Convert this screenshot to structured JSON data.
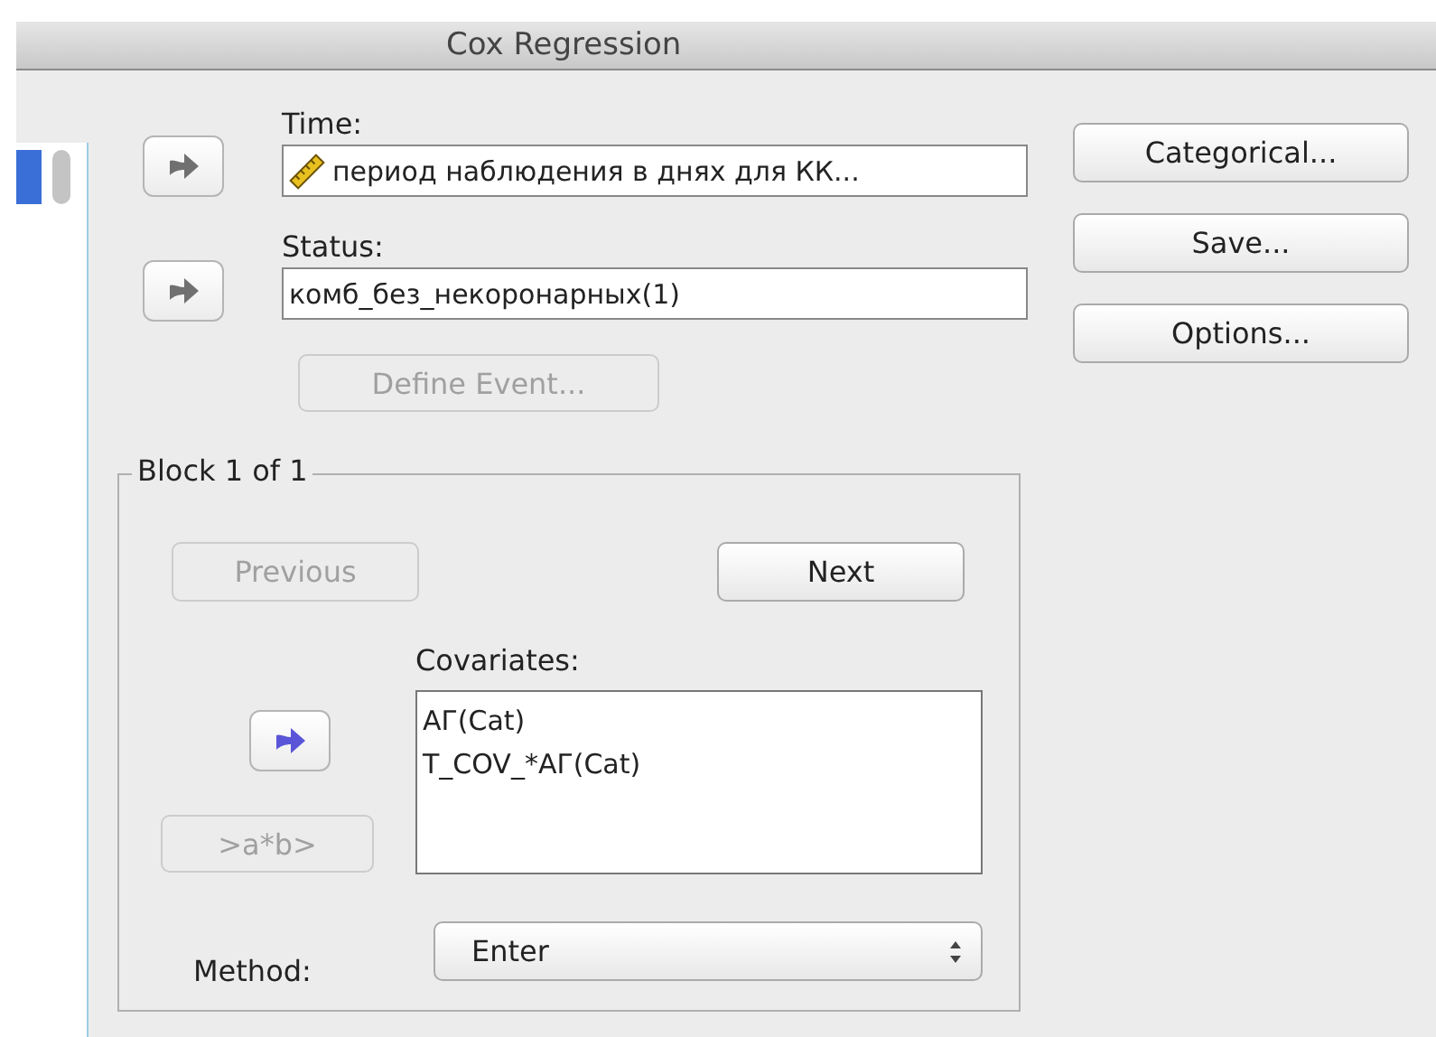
{
  "window": {
    "title": "Cox Regression"
  },
  "source_list": {
    "rows": [
      {
        "selected": true
      }
    ]
  },
  "time": {
    "label": "Time:",
    "value": "период наблюдения в днях для КК...",
    "scale_icon": true,
    "move_button": {
      "disabled": true
    }
  },
  "status": {
    "label": "Status:",
    "value": "комб_без_некоронарных(1)",
    "move_button": {
      "disabled": true
    }
  },
  "define_event_button": {
    "label": "Define Event...",
    "disabled": true
  },
  "side_buttons": [
    {
      "label": "Categorical...",
      "disabled": false
    },
    {
      "label": "Save...",
      "disabled": false
    },
    {
      "label": "Options...",
      "disabled": false
    }
  ],
  "block": {
    "title": "Block 1 of 1",
    "previous_button": {
      "label": "Previous",
      "disabled": true
    },
    "next_button": {
      "label": "Next",
      "disabled": false
    },
    "covariates": {
      "label": "Covariates:",
      "items": [
        "АГ(Cat)",
        "T_COV_*АГ(Cat)"
      ],
      "move_button": {
        "disabled": false
      }
    },
    "interaction_button": {
      "label": ">a*b>",
      "disabled": true
    },
    "method": {
      "label": "Method:",
      "value": "Enter"
    }
  }
}
